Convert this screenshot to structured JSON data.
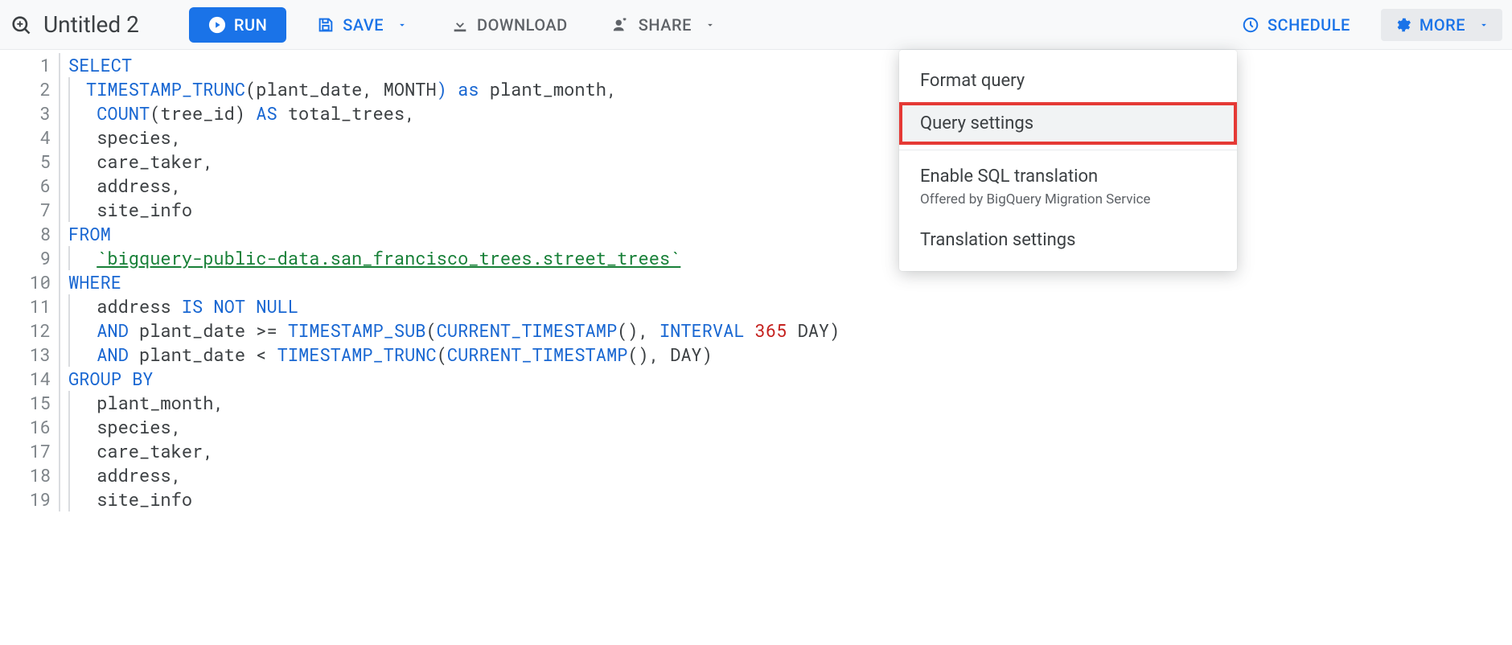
{
  "header": {
    "title": "Untitled 2",
    "run": "RUN",
    "save": "SAVE",
    "download": "DOWNLOAD",
    "share": "SHARE",
    "schedule": "SCHEDULE",
    "more": "MORE"
  },
  "menu": {
    "format": "Format query",
    "settings": "Query settings",
    "enable_translation": "Enable SQL translation",
    "enable_translation_sub": "Offered by BigQuery Migration Service",
    "translation_settings": "Translation settings"
  },
  "editor": {
    "line_count": 19,
    "lines": [
      {
        "indent": 0,
        "tokens": [
          {
            "t": "SELECT",
            "c": "kw"
          }
        ]
      },
      {
        "indent": 1,
        "tokens": [
          {
            "t": "TIMESTAMP_TRUNC",
            "c": "kw"
          },
          {
            "t": "("
          },
          {
            "t": "plant_date"
          },
          {
            "t": ","
          },
          {
            "t": " MONTH"
          },
          {
            "t": ")",
            "c": "kw"
          },
          {
            "t": " "
          },
          {
            "t": "as",
            "c": "kw"
          },
          {
            "t": " plant_month,"
          }
        ]
      },
      {
        "indent": 1,
        "tokens": [
          {
            "t": " "
          },
          {
            "t": "COUNT",
            "c": "kw"
          },
          {
            "t": "("
          },
          {
            "t": "tree_id"
          },
          {
            "t": ")"
          },
          {
            "t": " "
          },
          {
            "t": "AS",
            "c": "kw"
          },
          {
            "t": " total_trees,"
          }
        ]
      },
      {
        "indent": 1,
        "tokens": [
          {
            "t": " species,"
          }
        ]
      },
      {
        "indent": 1,
        "tokens": [
          {
            "t": " care_taker,"
          }
        ]
      },
      {
        "indent": 1,
        "tokens": [
          {
            "t": " address,"
          }
        ]
      },
      {
        "indent": 1,
        "tokens": [
          {
            "t": " site_info"
          }
        ]
      },
      {
        "indent": 0,
        "tokens": [
          {
            "t": "FROM",
            "c": "kw"
          }
        ]
      },
      {
        "indent": 1,
        "tokens": [
          {
            "t": " "
          },
          {
            "t": "`bigquery-public-data.san_francisco_trees.street_trees`",
            "c": "tableref"
          }
        ]
      },
      {
        "indent": 0,
        "tokens": [
          {
            "t": "WHERE",
            "c": "kw"
          }
        ]
      },
      {
        "indent": 1,
        "tokens": [
          {
            "t": " address "
          },
          {
            "t": "IS NOT NULL",
            "c": "kw"
          }
        ]
      },
      {
        "indent": 1,
        "tokens": [
          {
            "t": " "
          },
          {
            "t": "AND",
            "c": "kw"
          },
          {
            "t": " plant_date >= "
          },
          {
            "t": "TIMESTAMP_SUB",
            "c": "kw"
          },
          {
            "t": "("
          },
          {
            "t": "CURRENT_TIMESTAMP",
            "c": "kw"
          },
          {
            "t": "(),"
          },
          {
            "t": " "
          },
          {
            "t": "INTERVAL",
            "c": "kw"
          },
          {
            "t": " "
          },
          {
            "t": "365",
            "c": "num"
          },
          {
            "t": " DAY"
          },
          {
            "t": ")"
          }
        ]
      },
      {
        "indent": 1,
        "tokens": [
          {
            "t": " "
          },
          {
            "t": "AND",
            "c": "kw"
          },
          {
            "t": " plant_date < "
          },
          {
            "t": "TIMESTAMP_TRUNC",
            "c": "kw"
          },
          {
            "t": "("
          },
          {
            "t": "CURRENT_TIMESTAMP",
            "c": "kw"
          },
          {
            "t": "(),"
          },
          {
            "t": " DAY"
          },
          {
            "t": ")"
          }
        ]
      },
      {
        "indent": 0,
        "tokens": [
          {
            "t": "GROUP BY",
            "c": "kw"
          }
        ]
      },
      {
        "indent": 1,
        "tokens": [
          {
            "t": " plant_month,"
          }
        ]
      },
      {
        "indent": 1,
        "tokens": [
          {
            "t": " species,"
          }
        ]
      },
      {
        "indent": 1,
        "tokens": [
          {
            "t": " care_taker,"
          }
        ]
      },
      {
        "indent": 1,
        "tokens": [
          {
            "t": " address,"
          }
        ]
      },
      {
        "indent": 1,
        "tokens": [
          {
            "t": " site_info"
          }
        ]
      }
    ]
  }
}
